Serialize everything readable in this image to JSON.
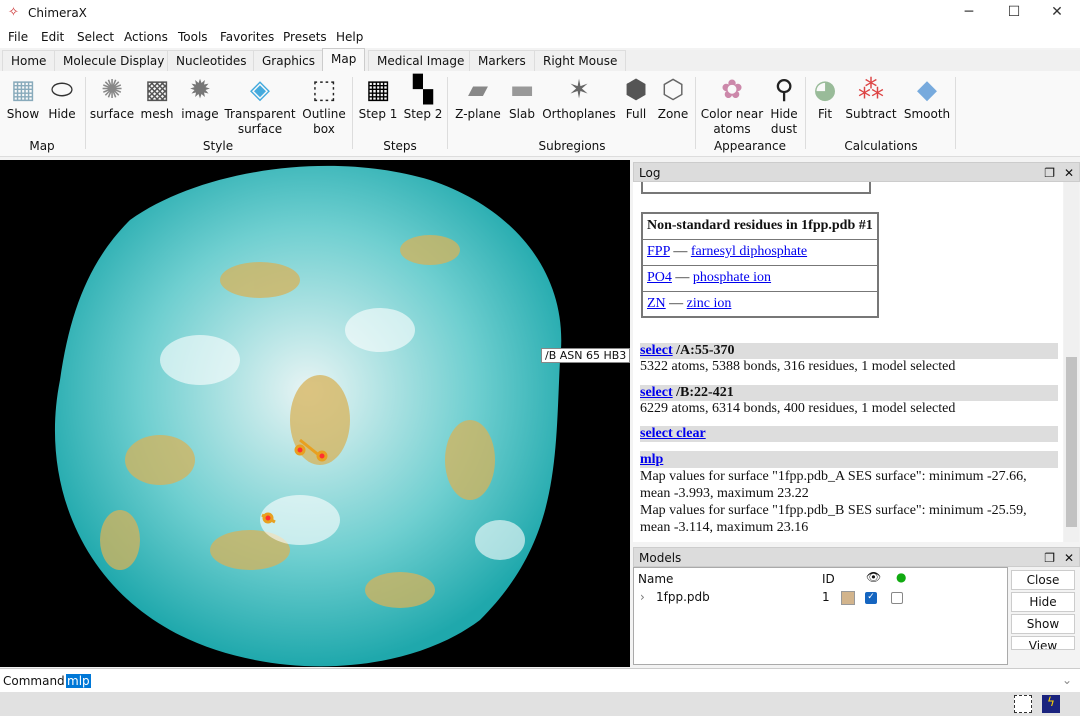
{
  "window": {
    "title": "ChimeraX",
    "minimize": "─",
    "maximize": "☐",
    "close": "✕"
  },
  "menu": [
    "File",
    "Edit",
    "Select",
    "Actions",
    "Tools",
    "Favorites",
    "Presets",
    "Help"
  ],
  "tabs": [
    "Home",
    "Molecule Display",
    "Nucleotides",
    "Graphics",
    "Map",
    "Medical Image",
    "Markers",
    "Right Mouse"
  ],
  "active_tab": "Map",
  "ribbon": {
    "buttons": [
      {
        "label": "Show",
        "icon": "map-show-icon"
      },
      {
        "label": "Hide",
        "icon": "map-hide-icon"
      },
      {
        "label": "surface",
        "icon": "surface-icon"
      },
      {
        "label": "mesh",
        "icon": "mesh-icon"
      },
      {
        "label": "image",
        "icon": "image-icon"
      },
      {
        "label": "Transparent\nsurface",
        "icon": "transparent-surface-icon"
      },
      {
        "label": "Outline\nbox",
        "icon": "outline-box-icon"
      },
      {
        "label": "Step 1",
        "icon": "step1-icon"
      },
      {
        "label": "Step 2",
        "icon": "step2-icon"
      },
      {
        "label": "Z-plane",
        "icon": "z-plane-icon"
      },
      {
        "label": "Slab",
        "icon": "slab-icon"
      },
      {
        "label": "Orthoplanes",
        "icon": "orthoplanes-icon"
      },
      {
        "label": "Full",
        "icon": "full-icon"
      },
      {
        "label": "Zone",
        "icon": "zone-icon"
      },
      {
        "label": "Color near\natoms",
        "icon": "color-near-atoms-icon"
      },
      {
        "label": "Hide\ndust",
        "icon": "hide-dust-icon"
      },
      {
        "label": "Fit",
        "icon": "fit-icon"
      },
      {
        "label": "Subtract",
        "icon": "subtract-icon"
      },
      {
        "label": "Smooth",
        "icon": "smooth-icon"
      }
    ],
    "groups": [
      "Map",
      "Style",
      "Steps",
      "Subregions",
      "Appearance",
      "Calculations"
    ]
  },
  "viewport": {
    "hover_label": "/B ASN 65 HB3"
  },
  "log": {
    "title": "Log",
    "table_title": "Non-standard residues in 1fpp.pdb #1",
    "residues": [
      {
        "code": "FPP",
        "name": "farnesyl diphosphate"
      },
      {
        "code": "PO4",
        "name": "phosphate ion"
      },
      {
        "code": "ZN",
        "name": "zinc ion"
      }
    ],
    "dash": "—",
    "entries": [
      {
        "cmd": "select",
        "args": " /A:55-370",
        "output": [
          "5322 atoms, 5388 bonds, 316 residues, 1 model selected"
        ]
      },
      {
        "cmd": "select",
        "args": " /B:22-421",
        "output": [
          "6229 atoms, 6314 bonds, 400 residues, 1 model selected"
        ]
      },
      {
        "cmd": "select clear",
        "args": "",
        "output": []
      },
      {
        "cmd": "mlp",
        "args": "",
        "output": [
          "Map values for surface \"1fpp.pdb_A SES surface\": minimum -27.66, mean -3.993, maximum 23.22",
          "Map values for surface \"1fpp.pdb_B SES surface\": minimum -25.59, mean -3.114, maximum 23.16"
        ]
      }
    ]
  },
  "models": {
    "title": "Models",
    "columns": {
      "name": "Name",
      "id": "ID"
    },
    "rows": [
      {
        "name": "1fpp.pdb",
        "id": "1",
        "color": "#d2b48c",
        "shown": true,
        "selected": false
      }
    ],
    "buttons": [
      "Close",
      "Hide",
      "Show",
      "View"
    ]
  },
  "command": {
    "label": "Command:",
    "value": "mlp"
  }
}
